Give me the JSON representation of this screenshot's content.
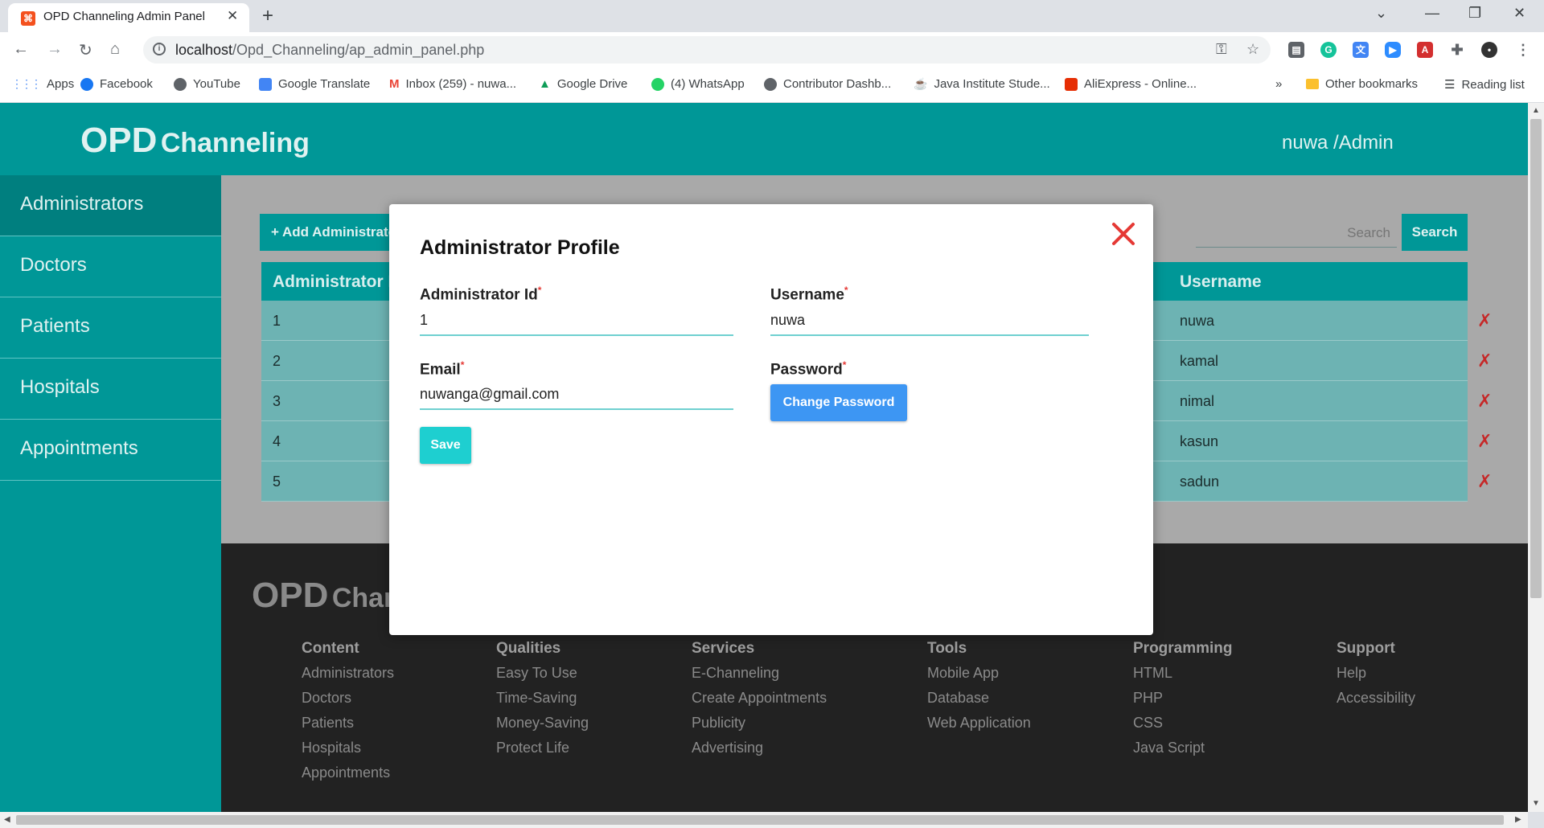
{
  "browser": {
    "tab_title": "OPD Channeling Admin Panel",
    "url_host": "localhost",
    "url_path": "/Opd_Channeling/ap_admin_panel.php",
    "bookmarks": [
      {
        "label": "Apps",
        "icon": "apps-grid-icon",
        "color": "#4285f4"
      },
      {
        "label": "Facebook",
        "icon": "facebook-icon",
        "color": "#1877f2"
      },
      {
        "label": "YouTube",
        "icon": "globe-icon",
        "color": "#5f6368"
      },
      {
        "label": "Google Translate",
        "icon": "translate-icon",
        "color": "#4285f4"
      },
      {
        "label": "Inbox (259) - nuwa...",
        "icon": "gmail-icon",
        "color": "#ea4335"
      },
      {
        "label": "Google Drive",
        "icon": "drive-icon",
        "color": "#0f9d58"
      },
      {
        "label": "(4) WhatsApp",
        "icon": "whatsapp-icon",
        "color": "#25d366"
      },
      {
        "label": "Contributor Dashb...",
        "icon": "globe-icon",
        "color": "#5f6368"
      },
      {
        "label": "Java Institute Stude...",
        "icon": "java-icon",
        "color": "#e53935"
      },
      {
        "label": "AliExpress - Online...",
        "icon": "aliexpress-icon",
        "color": "#e62e04"
      }
    ],
    "other_bookmarks": "Other bookmarks",
    "reading_list": "Reading list",
    "more_bookmarks": "»"
  },
  "header": {
    "logo_big": "OPD",
    "logo_small": "Channeling",
    "user": "nuwa /Admin"
  },
  "sidebar": {
    "items": [
      {
        "label": "Administrators",
        "active": true
      },
      {
        "label": "Doctors"
      },
      {
        "label": "Patients"
      },
      {
        "label": "Hospitals"
      },
      {
        "label": "Appointments"
      }
    ]
  },
  "content": {
    "add_button": "+ Add Administrator",
    "search_placeholder": "Search",
    "search_button": "Search",
    "table": {
      "headers": [
        "Administrator Id",
        "Username"
      ],
      "rows": [
        {
          "id": "1",
          "username": "nuwa"
        },
        {
          "id": "2",
          "username": "kamal"
        },
        {
          "id": "3",
          "username": "nimal"
        },
        {
          "id": "4",
          "username": "kasun"
        },
        {
          "id": "5",
          "username": "sadun"
        }
      ],
      "delete_symbol": "✗"
    }
  },
  "footer": {
    "logo_big": "OPD",
    "logo_small": "Channeling",
    "columns": [
      {
        "heading": "Content",
        "items": [
          "Administrators",
          "Doctors",
          "Patients",
          "Hospitals",
          "Appointments"
        ]
      },
      {
        "heading": "Qualities",
        "items": [
          "Easy To Use",
          "Time-Saving",
          "Money-Saving",
          "Protect Life"
        ]
      },
      {
        "heading": "Services",
        "items": [
          "E-Channeling",
          "Create Appointments",
          "Publicity",
          "Advertising"
        ]
      },
      {
        "heading": "Tools",
        "items": [
          "Mobile App",
          "Database",
          "Web Application"
        ]
      },
      {
        "heading": "Programming",
        "items": [
          "HTML",
          "PHP",
          "CSS",
          "Java Script"
        ]
      },
      {
        "heading": "Support",
        "items": [
          "Help",
          "Accessibility"
        ]
      }
    ]
  },
  "modal": {
    "title": "Administrator Profile",
    "admin_id_label": "Administrator Id",
    "admin_id_value": "1",
    "username_label": "Username",
    "username_value": "nuwa",
    "email_label": "Email",
    "email_value": "nuwanga@gmail.com",
    "password_label": "Password",
    "change_password_button": "Change Password",
    "save_button": "Save",
    "required_mark": "*"
  },
  "colors": {
    "teal": "#009797",
    "close_red": "#e53935",
    "change_pw_blue": "#3d96f3",
    "save_cyan": "#1ecfd0"
  }
}
